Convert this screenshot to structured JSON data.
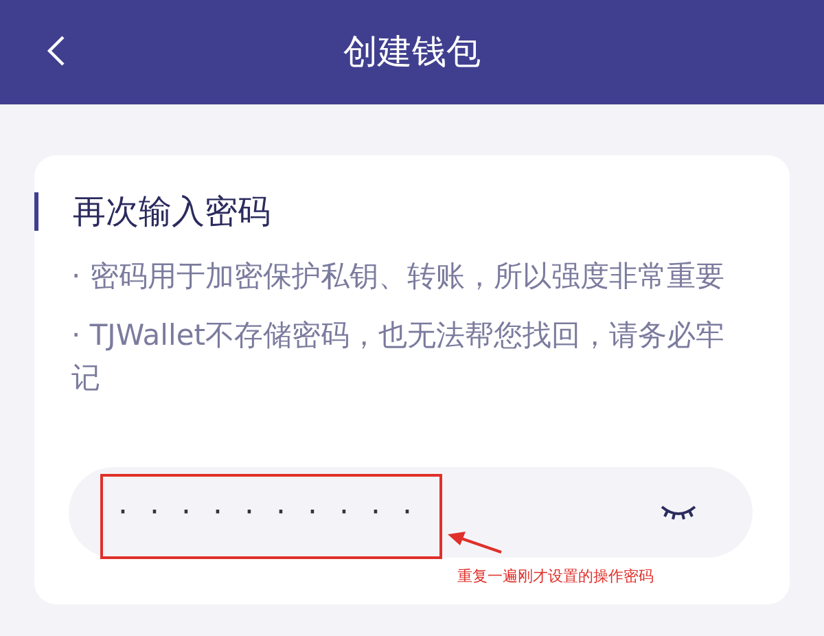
{
  "header": {
    "title": "创建钱包"
  },
  "card": {
    "title": "再次输入密码",
    "notes": [
      "·  密码用于加密保护私钥、转账，所以强度非常重要",
      "·  TJWallet不存储密码，也无法帮您找回，请务必牢记"
    ],
    "password_field": {
      "value": "··········",
      "revealed": false
    }
  },
  "annotation": {
    "text": "重复一遍刚才设置的操作密码"
  }
}
